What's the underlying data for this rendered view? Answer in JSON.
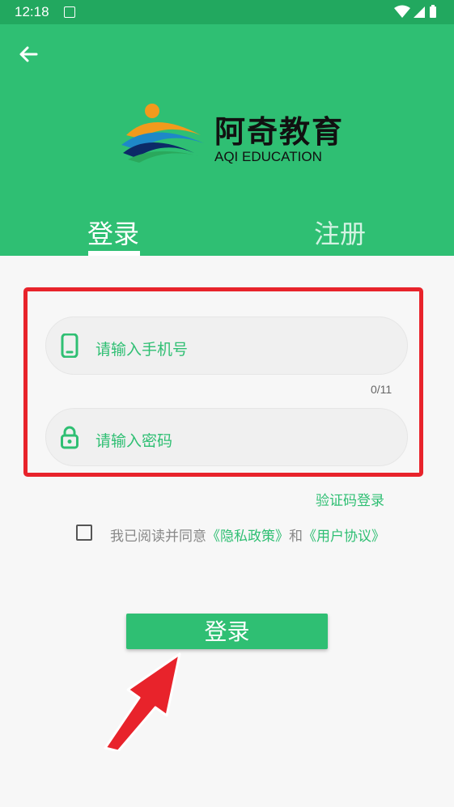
{
  "status_bar": {
    "time": "12:18",
    "icons": [
      "notification-a-icon",
      "wifi-icon",
      "signal-icon",
      "battery-icon"
    ]
  },
  "header": {
    "back_icon": "arrow-left-icon",
    "logo_cn": "阿奇教育",
    "logo_en": "AQI EDUCATION",
    "tabs": [
      {
        "label": "登录",
        "active": true
      },
      {
        "label": "注册",
        "active": false
      }
    ]
  },
  "form": {
    "phone_placeholder": "请输入手机号",
    "phone_value": "",
    "phone_counter": "0/11",
    "password_placeholder": "请输入密码",
    "password_value": "",
    "sms_login_label": "验证码登录",
    "agreement": {
      "checked": false,
      "prefix": "我已阅读并同意",
      "privacy_link": "《隐私政策》",
      "joiner": "和",
      "terms_link": "《用户协议》"
    },
    "submit_label": "登录"
  },
  "colors": {
    "brand_green": "#2fbf73",
    "status_bar_green": "#22a85f",
    "highlight_red": "#e8232b",
    "background": "#f7f7f7"
  }
}
